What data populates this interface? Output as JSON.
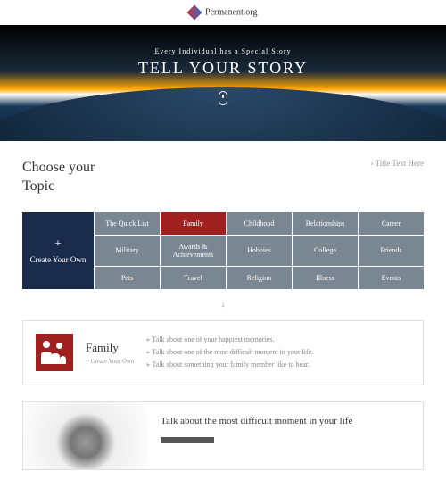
{
  "brand": "Permanent.org",
  "hero": {
    "subtitle": "Every Individual has a  Special Story",
    "title": "TELL YOUR STORY"
  },
  "section": {
    "heading_line1": "Choose your",
    "heading_line2": "Topic",
    "right_link": "Title Text Here"
  },
  "grid": {
    "create_label": "Create Your Own",
    "topics": [
      [
        "The Quick List",
        "Family",
        "Childhood",
        "Relationships",
        "Career"
      ],
      [
        "Military",
        "Awards & Achievements",
        "Hobbies",
        "College",
        "Friends"
      ],
      [
        "Pets",
        "Travel",
        "Religion",
        "Illness",
        "Events"
      ]
    ],
    "active": "Family"
  },
  "topic_card": {
    "name": "Family",
    "sub": "+ Create Your Own",
    "prompts": [
      "Talk about one of your happiest memories.",
      "Talk about one of the most difficult moment in your life.",
      "Talk about something your family member like to hear."
    ]
  },
  "article": {
    "title": "Talk about the most difficult moment in your life"
  }
}
